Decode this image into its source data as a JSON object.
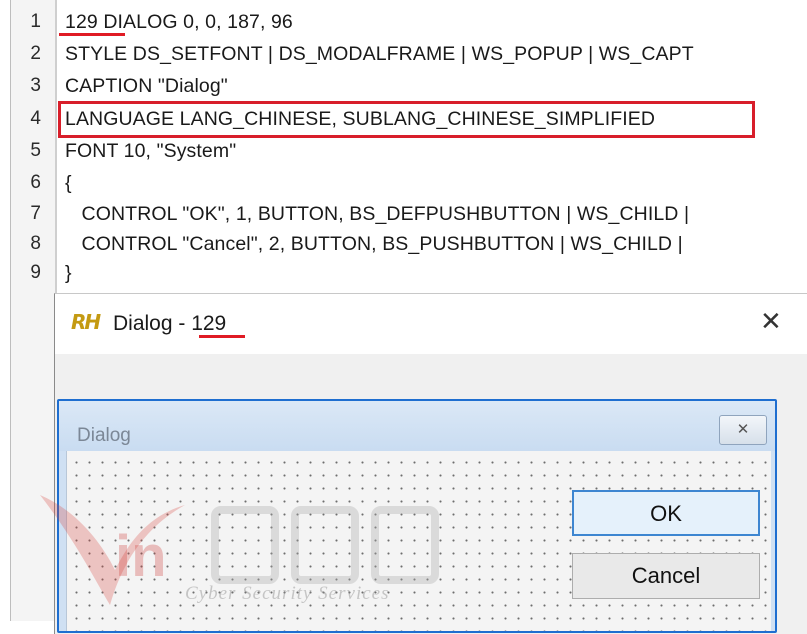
{
  "editor": {
    "lines": [
      {
        "number": "1",
        "text": "129 DIALOG 0, 0, 187, 96"
      },
      {
        "number": "2",
        "text": "STYLE DS_SETFONT | DS_MODALFRAME | WS_POPUP | WS_CAPT"
      },
      {
        "number": "3",
        "text": "CAPTION \"Dialog\""
      },
      {
        "number": "4",
        "text": "LANGUAGE LANG_CHINESE, SUBLANG_CHINESE_SIMPLIFIED"
      },
      {
        "number": "5",
        "text": "FONT 10, \"System\""
      },
      {
        "number": "6",
        "text": "{"
      },
      {
        "number": "7",
        "text": "   CONTROL \"OK\", 1, BUTTON, BS_DEFPUSHBUTTON | WS_CHILD |"
      },
      {
        "number": "8",
        "text": "   CONTROL \"Cancel\", 2, BUTTON, BS_PUSHBUTTON | WS_CHILD |"
      },
      {
        "number": "9",
        "text": "}"
      }
    ]
  },
  "resource_window": {
    "logo_text": "RH",
    "title": "Dialog - 129",
    "close_glyph": "✕"
  },
  "dialog_preview": {
    "caption": "Dialog",
    "close_glyph": "✕",
    "buttons": {
      "ok": "OK",
      "cancel": "Cancel"
    }
  },
  "watermark": {
    "text": "in",
    "subtitle": "Cyber Security Services"
  },
  "colors": {
    "annotation_red": "#e01b24",
    "default_button_border": "#3d86d1",
    "preview_frame": "#1e6ed0",
    "logo": "#c49a12"
  }
}
